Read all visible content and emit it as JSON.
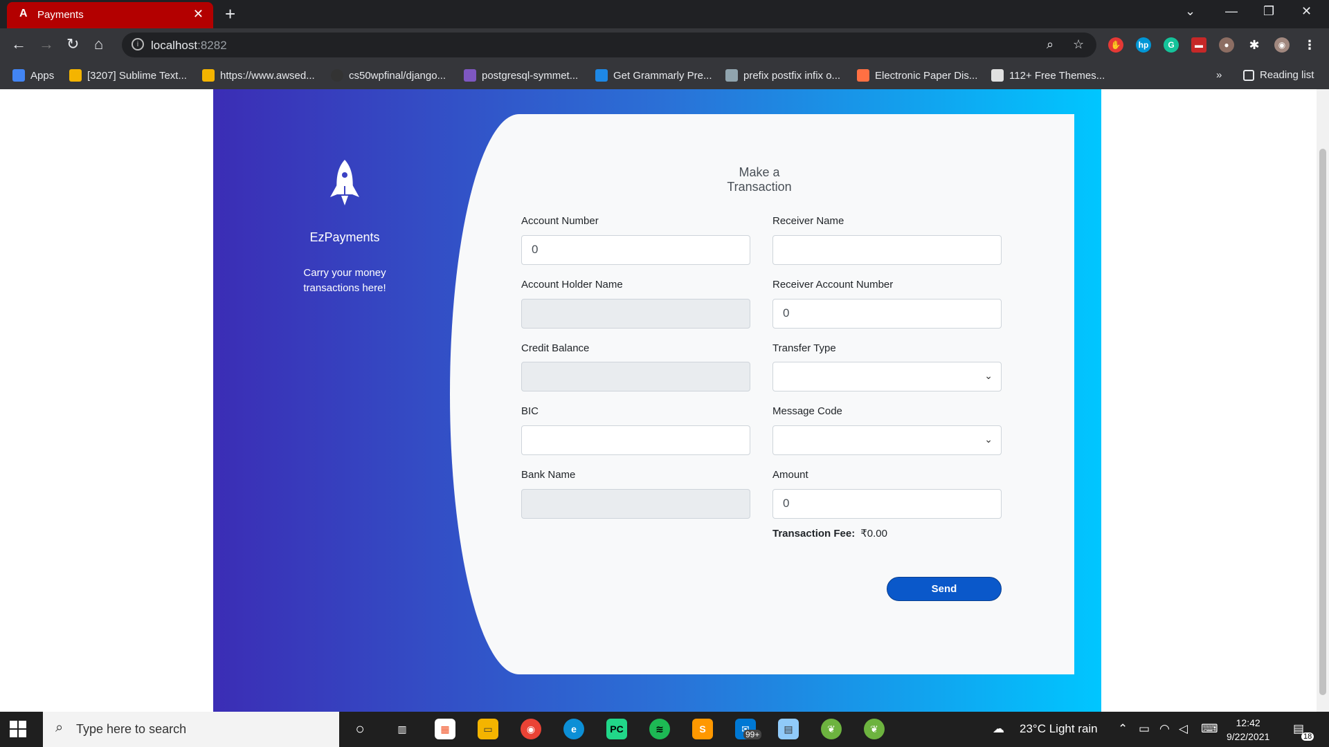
{
  "browser": {
    "tab_title": "Payments",
    "tab_icon_text": "A",
    "url_host": "localhost",
    "url_port": ":8282",
    "bookmarks": [
      {
        "label": "Apps",
        "color": "#4285f4"
      },
      {
        "label": "[3207] Sublime Text...",
        "color": "#f4b400"
      },
      {
        "label": "https://www.awsed...",
        "color": "#f4b400"
      },
      {
        "label": "cs50wpfinal/django...",
        "color": "#333333"
      },
      {
        "label": "postgresql-symmet...",
        "color": "#7e57c2"
      },
      {
        "label": "Get Grammarly Pre...",
        "color": "#1e88e5"
      },
      {
        "label": "prefix postfix infix o...",
        "color": "#90a4ae"
      },
      {
        "label": "Electronic Paper Dis...",
        "color": "#ff7043"
      },
      {
        "label": "112+ Free Themes...",
        "color": "#e0e0e0"
      }
    ],
    "more_bookmarks": "»",
    "reading_list": "Reading list"
  },
  "sidebar": {
    "brand_name": "EzPayments",
    "tagline_line1": "Carry your money",
    "tagline_line2": "transactions here!"
  },
  "form": {
    "title": "Make a Transaction",
    "account_number_label": "Account Number",
    "account_number_value": "0",
    "account_holder_label": "Account Holder Name",
    "credit_balance_label": "Credit Balance",
    "bic_label": "BIC",
    "bank_name_label": "Bank Name",
    "receiver_name_label": "Receiver Name",
    "receiver_account_label": "Receiver Account Number",
    "receiver_account_value": "0",
    "transfer_type_label": "Transfer Type",
    "message_code_label": "Message Code",
    "amount_label": "Amount",
    "amount_value": "0",
    "fee_label": "Transaction Fee:",
    "fee_value": "₹0.00",
    "send_label": "Send"
  },
  "taskbar": {
    "search_placeholder": "Type here to search",
    "mail_badge": "99+",
    "weather": "23°C  Light rain",
    "time": "12:42",
    "date": "9/22/2021",
    "notification_count": "18"
  },
  "colors": {
    "gradient_start": "#3b2db5",
    "gradient_end": "#00c6ff",
    "send_button": "#0a58ca",
    "tab_active": "#b30000"
  }
}
